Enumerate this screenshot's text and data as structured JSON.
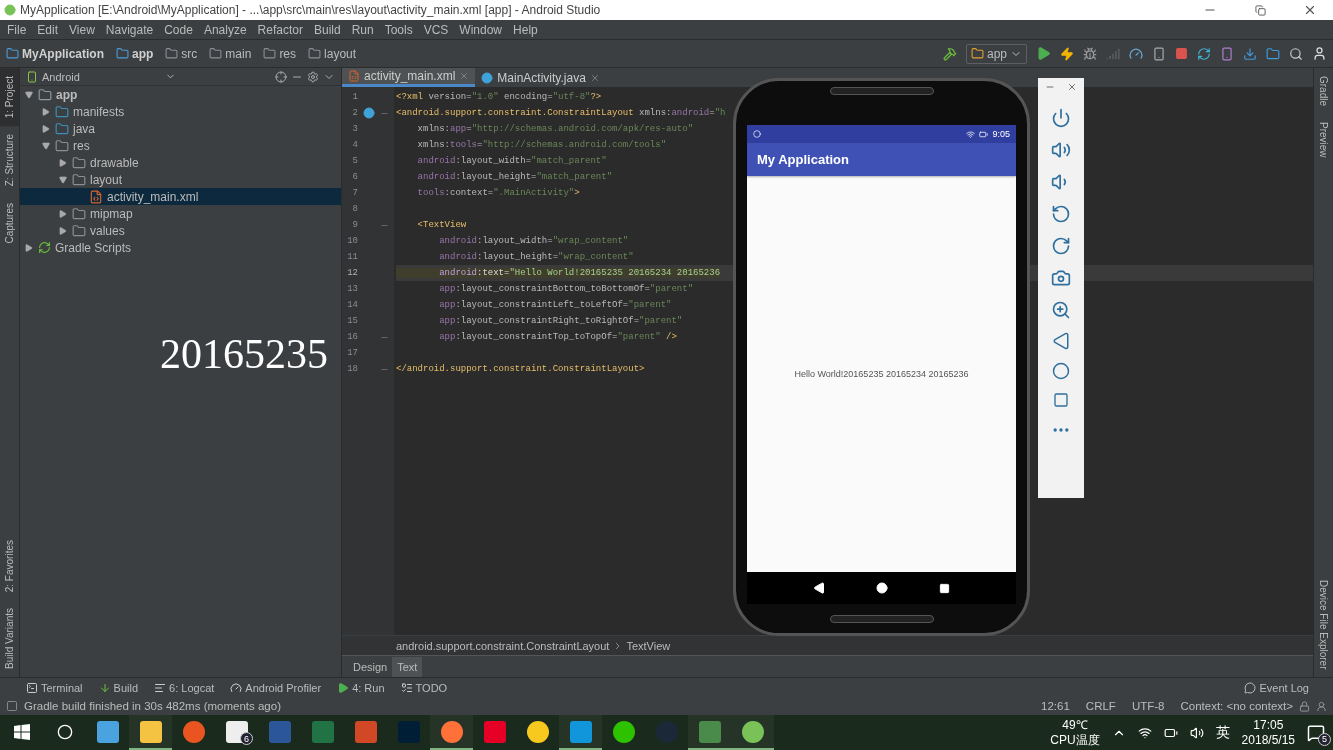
{
  "window": {
    "title": "MyApplication [E:\\Android\\MyApplication] - ...\\app\\src\\main\\res\\layout\\activity_main.xml [app] - Android Studio"
  },
  "menu": [
    "File",
    "Edit",
    "View",
    "Navigate",
    "Code",
    "Analyze",
    "Refactor",
    "Build",
    "Run",
    "Tools",
    "VCS",
    "Window",
    "Help"
  ],
  "breadcrumbs": [
    {
      "label": "MyApplication",
      "kind": "module"
    },
    {
      "label": "app",
      "kind": "module"
    },
    {
      "label": "src",
      "kind": "folder"
    },
    {
      "label": "main",
      "kind": "folder"
    },
    {
      "label": "res",
      "kind": "res"
    },
    {
      "label": "layout",
      "kind": "folder"
    }
  ],
  "run_config": {
    "label": "app"
  },
  "left_tool_tabs": {
    "top": [
      {
        "label": "1: Project",
        "selected": true
      },
      {
        "label": "Z: Structure",
        "selected": false
      },
      {
        "label": "Captures",
        "selected": false
      }
    ],
    "bottom": [
      {
        "label": "2: Favorites",
        "selected": false
      },
      {
        "label": "Build Variants",
        "selected": false
      }
    ]
  },
  "right_tool_tabs": {
    "top": [
      {
        "label": "Gradle"
      },
      {
        "label": "Preview"
      }
    ],
    "bottom": [
      {
        "label": "Device File Explorer"
      }
    ]
  },
  "project_panel": {
    "view": "Android",
    "tree": [
      {
        "label": "app",
        "kind": "module",
        "expanded": true,
        "selected": false,
        "children": [
          {
            "label": "manifests",
            "kind": "folder",
            "expanded": false,
            "selected": false
          },
          {
            "label": "java",
            "kind": "folder",
            "expanded": false,
            "selected": false
          },
          {
            "label": "res",
            "kind": "res",
            "expanded": true,
            "selected": false,
            "children": [
              {
                "label": "drawable",
                "kind": "resfolder",
                "expanded": false,
                "selected": false
              },
              {
                "label": "layout",
                "kind": "resfolder",
                "expanded": true,
                "selected": false,
                "children": [
                  {
                    "label": "activity_main.xml",
                    "kind": "file",
                    "selected": true
                  }
                ]
              },
              {
                "label": "mipmap",
                "kind": "resfolder",
                "expanded": false,
                "selected": false
              },
              {
                "label": "values",
                "kind": "resfolder",
                "expanded": false,
                "selected": false
              }
            ]
          }
        ]
      },
      {
        "label": "Gradle Scripts",
        "kind": "gradle",
        "expanded": false,
        "selected": false
      }
    ]
  },
  "overlay_text": "20165235",
  "editor": {
    "tabs": [
      {
        "label": "activity_main.xml",
        "kind": "xml",
        "selected": true
      },
      {
        "label": "MainActivity.java",
        "kind": "java",
        "selected": false
      }
    ],
    "lines": [
      {
        "number": "1",
        "current": false,
        "fold": false,
        "marker": false,
        "segments": [
          {
            "kind": "tag",
            "text": "<?xml"
          },
          {
            "kind": "attr",
            "text": " version="
          },
          {
            "kind": "value",
            "text": "\"1.0\""
          },
          {
            "kind": "attr",
            "text": " encoding="
          },
          {
            "kind": "value",
            "text": "\"utf-8\""
          },
          {
            "kind": "tag",
            "text": "?>"
          }
        ]
      },
      {
        "number": "2",
        "current": false,
        "fold": true,
        "marker": true,
        "segments": [
          {
            "kind": "tag",
            "text": "<android.support.constraint.ConstraintLayout"
          },
          {
            "kind": "attr",
            "text": " xmlns:"
          },
          {
            "kind": "ns",
            "text": "android"
          },
          {
            "kind": "attr",
            "text": "="
          },
          {
            "kind": "value",
            "text": "\"h"
          }
        ]
      },
      {
        "number": "3",
        "current": false,
        "fold": false,
        "marker": false,
        "segments": [
          {
            "kind": "attr",
            "text": "    xmlns:"
          },
          {
            "kind": "ns",
            "text": "app"
          },
          {
            "kind": "attr",
            "text": "="
          },
          {
            "kind": "value",
            "text": "\"http://schemas.android.com/apk/res-auto\""
          }
        ]
      },
      {
        "number": "4",
        "current": false,
        "fold": false,
        "marker": false,
        "segments": [
          {
            "kind": "attr",
            "text": "    xmlns:"
          },
          {
            "kind": "ns",
            "text": "tools"
          },
          {
            "kind": "attr",
            "text": "="
          },
          {
            "kind": "value",
            "text": "\"http://schemas.android.com/tools\""
          }
        ]
      },
      {
        "number": "5",
        "current": false,
        "fold": false,
        "marker": false,
        "segments": [
          {
            "kind": "ns",
            "text": "    android"
          },
          {
            "kind": "attr",
            "text": ":layout_width="
          },
          {
            "kind": "value",
            "text": "\"match_parent\""
          }
        ]
      },
      {
        "number": "6",
        "current": false,
        "fold": false,
        "marker": false,
        "segments": [
          {
            "kind": "ns",
            "text": "    android"
          },
          {
            "kind": "attr",
            "text": ":layout_height="
          },
          {
            "kind": "value",
            "text": "\"match_parent\""
          }
        ]
      },
      {
        "number": "7",
        "current": false,
        "fold": false,
        "marker": false,
        "segments": [
          {
            "kind": "ns",
            "text": "    tools"
          },
          {
            "kind": "attr",
            "text": ":context="
          },
          {
            "kind": "value",
            "text": "\".MainActivity\""
          },
          {
            "kind": "tag",
            "text": ">"
          }
        ]
      },
      {
        "number": "8",
        "current": false,
        "fold": false,
        "marker": false
      },
      {
        "number": "9",
        "current": false,
        "fold": true,
        "marker": false,
        "segments": [
          {
            "kind": "tag",
            "text": "    <TextView"
          }
        ]
      },
      {
        "number": "10",
        "current": false,
        "fold": false,
        "marker": false,
        "segments": [
          {
            "kind": "ns",
            "text": "        android"
          },
          {
            "kind": "attr",
            "text": ":layout_width="
          },
          {
            "kind": "value",
            "text": "\"wrap_content\""
          }
        ]
      },
      {
        "number": "11",
        "current": false,
        "fold": false,
        "marker": false,
        "segments": [
          {
            "kind": "ns",
            "text": "        android"
          },
          {
            "kind": "attr",
            "text": ":layout_height="
          },
          {
            "kind": "value",
            "text": "\"wrap_content\""
          }
        ]
      },
      {
        "number": "12",
        "current": true,
        "fold": false,
        "marker": false,
        "segments": [
          {
            "kind": "ns",
            "text": "        android"
          },
          {
            "kind": "attr",
            "text": ":text="
          },
          {
            "kind": "value",
            "text": "\"Hello World!20165235 20165234 20165236"
          }
        ]
      },
      {
        "number": "13",
        "current": false,
        "fold": false,
        "marker": false,
        "segments": [
          {
            "kind": "ns",
            "text": "        app"
          },
          {
            "kind": "attr",
            "text": ":layout_constraintBottom_toBottomOf="
          },
          {
            "kind": "value",
            "text": "\"parent\""
          }
        ]
      },
      {
        "number": "14",
        "current": false,
        "fold": false,
        "marker": false,
        "segments": [
          {
            "kind": "ns",
            "text": "        app"
          },
          {
            "kind": "attr",
            "text": ":layout_constraintLeft_toLeftOf="
          },
          {
            "kind": "value",
            "text": "\"parent\""
          }
        ]
      },
      {
        "number": "15",
        "current": false,
        "fold": false,
        "marker": false,
        "segments": [
          {
            "kind": "ns",
            "text": "        app"
          },
          {
            "kind": "attr",
            "text": ":layout_constraintRight_toRightOf="
          },
          {
            "kind": "value",
            "text": "\"parent\""
          }
        ]
      },
      {
        "number": "16",
        "current": false,
        "fold": true,
        "marker": false,
        "segments": [
          {
            "kind": "ns",
            "text": "        app"
          },
          {
            "kind": "attr",
            "text": ":layout_constraintTop_toTopOf="
          },
          {
            "kind": "value",
            "text": "\"parent\""
          },
          {
            "kind": "tag",
            "text": " />"
          }
        ]
      },
      {
        "number": "17",
        "current": false,
        "fold": false,
        "marker": false
      },
      {
        "number": "18",
        "current": false,
        "fold": true,
        "marker": false,
        "segments": [
          {
            "kind": "tag",
            "text": "</android.support.constraint.ConstraintLayout>"
          }
        ]
      }
    ],
    "path": [
      "android.support.constraint.ConstraintLayout",
      "TextView"
    ],
    "mode_tabs": [
      {
        "label": "Design",
        "selected": false
      },
      {
        "label": "Text",
        "selected": true
      }
    ]
  },
  "emulator": {
    "status_time": "9:05",
    "app_title": "My Application",
    "content_text": "Hello World!20165235 20165234 20165236"
  },
  "tool_windows": [
    {
      "label": "Terminal",
      "kind": "terminal"
    },
    {
      "label": "Build",
      "kind": "build"
    },
    {
      "label": "6: Logcat",
      "kind": "logcat"
    },
    {
      "label": "Android Profiler",
      "kind": "profiler"
    },
    {
      "label": "4: Run",
      "kind": "run"
    },
    {
      "label": "TODO",
      "kind": "todo"
    }
  ],
  "event_log": "Event Log",
  "status": {
    "message": "Gradle build finished in 30s 482ms (moments ago)",
    "items": [
      "12:61",
      "CRLF",
      "UTF-8",
      "Context: <no context>"
    ]
  },
  "taskbar": {
    "apps": [
      {
        "kind": "computer",
        "active": false
      },
      {
        "kind": "explorer",
        "active": true
      },
      {
        "kind": "ubuntu",
        "active": false
      },
      {
        "kind": "mail",
        "active": false,
        "badge": "6"
      },
      {
        "kind": "word",
        "active": false
      },
      {
        "kind": "excel",
        "active": false
      },
      {
        "kind": "powerpoint",
        "active": false
      },
      {
        "kind": "photoshop",
        "active": false
      },
      {
        "kind": "firefox",
        "active": true
      },
      {
        "kind": "netease",
        "active": false
      },
      {
        "kind": "music",
        "active": false
      },
      {
        "kind": "star",
        "active": true
      },
      {
        "kind": "chat",
        "active": false
      },
      {
        "kind": "steam",
        "active": false
      },
      {
        "kind": "emulator",
        "active": true
      },
      {
        "kind": "studio",
        "active": true
      }
    ],
    "temperature": "49℃",
    "temperature_label": "CPU温度",
    "ime": "英",
    "time": "17:05",
    "date": "2018/5/15",
    "notifications": "5"
  }
}
